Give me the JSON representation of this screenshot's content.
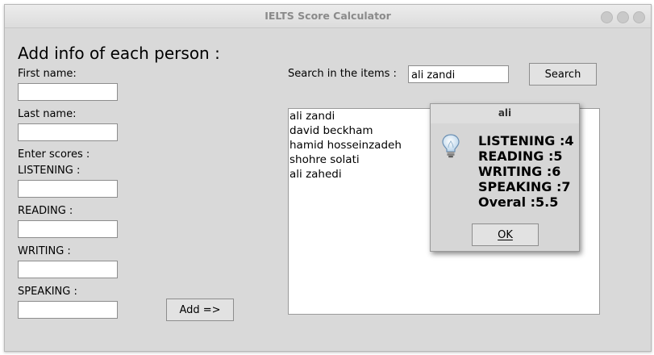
{
  "window": {
    "title": "IELTS Score Calculator"
  },
  "form": {
    "heading": "Add info of each person :",
    "first_name_label": "First name:",
    "last_name_label": "Last name:",
    "scores_label": "Enter scores :",
    "listening_label": "LISTENING :",
    "reading_label": "READING :",
    "writing_label": "WRITING :",
    "speaking_label": "SPEAKING :",
    "first_name_value": "",
    "last_name_value": "",
    "listening_value": "",
    "reading_value": "",
    "writing_value": "",
    "speaking_value": "",
    "add_button": "Add =>"
  },
  "search": {
    "label": "Search in the items :",
    "value": "ali zandi",
    "button": "Search"
  },
  "list": {
    "items": [
      "ali zandi",
      "david beckham",
      "hamid hosseinzadeh",
      "shohre solati",
      "ali zahedi"
    ]
  },
  "dialog": {
    "title": "ali",
    "icon": "lightbulb-icon",
    "lines": [
      "LISTENING :4",
      "READING :5",
      "WRITING :6",
      "SPEAKING :7",
      "Overal :5.5"
    ],
    "ok_button": "OK"
  }
}
